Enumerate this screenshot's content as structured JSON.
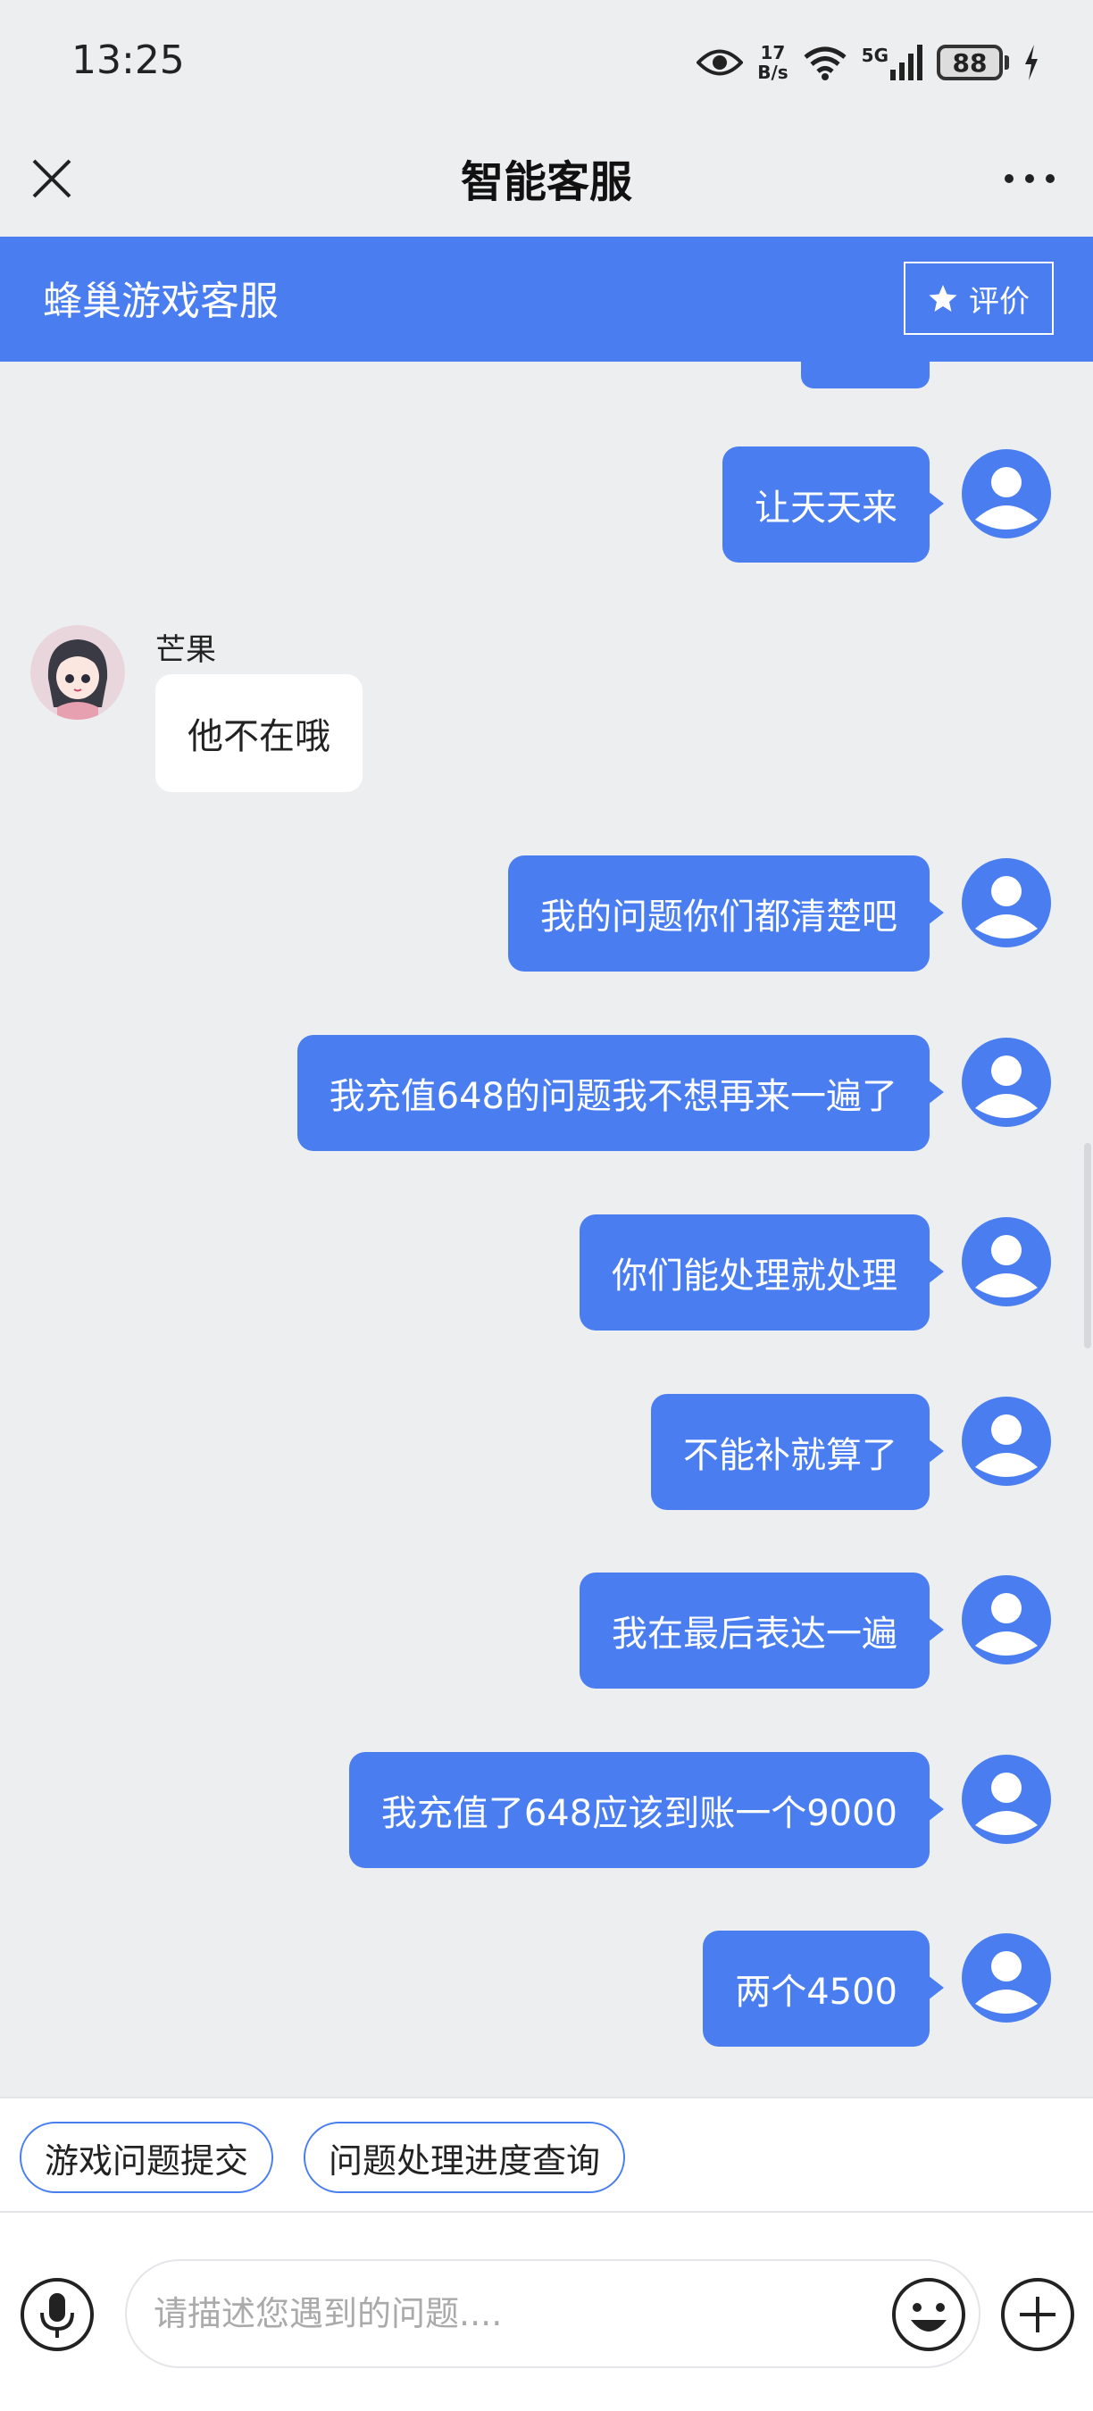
{
  "status": {
    "time": "13:25",
    "net_speed_value": "17",
    "net_speed_unit": "B/s",
    "network": "5G",
    "battery": "88"
  },
  "header": {
    "title": "智能客服"
  },
  "service_bar": {
    "name": "蜂巢游戏客服",
    "rate_label": "评价"
  },
  "messages": [
    {
      "from": "user",
      "text": "让天天来"
    },
    {
      "from": "agent",
      "name": "芒果",
      "text": "他不在哦"
    },
    {
      "from": "user",
      "text": "我的问题你们都清楚吧"
    },
    {
      "from": "user",
      "text": "我充值648的问题我不想再来一遍了"
    },
    {
      "from": "user",
      "text": "你们能处理就处理"
    },
    {
      "from": "user",
      "text": "不能补就算了"
    },
    {
      "from": "user",
      "text": "我在最后表达一遍"
    },
    {
      "from": "user",
      "text": "我充值了648应该到账一个9000"
    },
    {
      "from": "user",
      "text": "两个4500"
    }
  ],
  "quick_replies": [
    "游戏问题提交",
    "问题处理进度查询"
  ],
  "input": {
    "placeholder": "请描述您遇到的问题....",
    "value": ""
  },
  "colors": {
    "accent": "#4a7ef0",
    "background": "#edeef0"
  }
}
